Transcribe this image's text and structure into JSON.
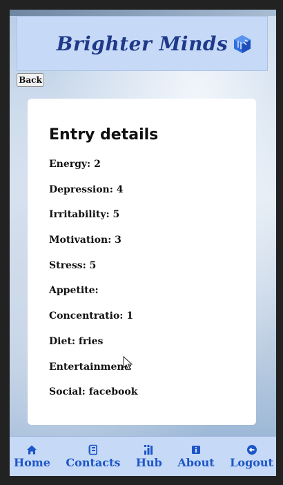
{
  "app": {
    "brand": "Brighter Minds"
  },
  "header": {
    "back_label": "Back"
  },
  "entry": {
    "title": "Entry details",
    "fields": [
      {
        "label": "Energy:",
        "value": "2"
      },
      {
        "label": "Depression:",
        "value": "4"
      },
      {
        "label": "Irritability:",
        "value": "5"
      },
      {
        "label": "Motivation:",
        "value": "3"
      },
      {
        "label": "Stress:",
        "value": "5"
      },
      {
        "label": "Appetite:",
        "value": ""
      },
      {
        "label": "Concentratio:",
        "value": "1"
      },
      {
        "label": "Diet:",
        "value": "fries"
      },
      {
        "label": "Entertainment:",
        "value": ""
      },
      {
        "label": "Social:",
        "value": "facebook"
      }
    ]
  },
  "nav": {
    "items": [
      {
        "label": "Home",
        "icon": "home-icon"
      },
      {
        "label": "Contacts",
        "icon": "contacts-icon"
      },
      {
        "label": "Hub",
        "icon": "hub-icon"
      },
      {
        "label": "About",
        "icon": "info-icon"
      },
      {
        "label": "Logout",
        "icon": "logout-icon"
      }
    ]
  },
  "colors": {
    "header_bg": "#c6d9f6",
    "brand": "#1f3a8a",
    "nav_accent": "#1d56c8"
  }
}
